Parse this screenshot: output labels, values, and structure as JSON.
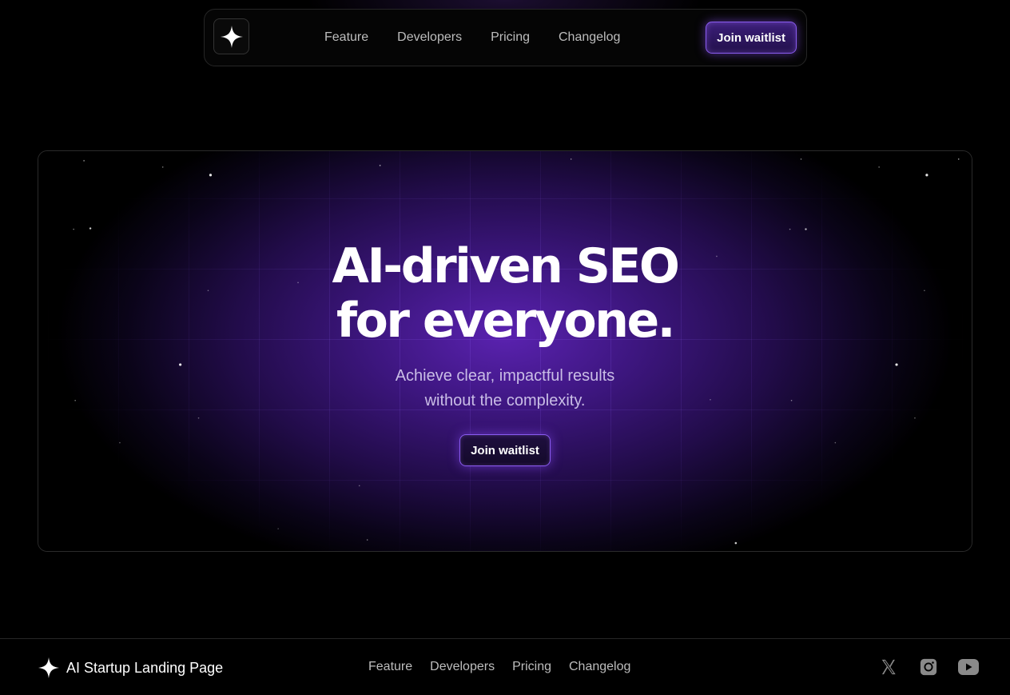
{
  "header": {
    "logo_icon": "sparkle-icon",
    "nav": [
      {
        "label": "Feature"
      },
      {
        "label": "Developers"
      },
      {
        "label": "Pricing"
      },
      {
        "label": "Changelog"
      }
    ],
    "cta_label": "Join waitlist"
  },
  "hero": {
    "title_line1": "AI-driven SEO",
    "title_line2": "for everyone.",
    "subtitle_line1": "Achieve clear, impactful results",
    "subtitle_line2": "without the complexity.",
    "cta_label": "Join waitlist"
  },
  "footer": {
    "brand_icon": "sparkle-icon",
    "brand": "AI Startup Landing Page",
    "nav": [
      {
        "label": "Feature"
      },
      {
        "label": "Developers"
      },
      {
        "label": "Pricing"
      },
      {
        "label": "Changelog"
      }
    ],
    "social": [
      {
        "icon": "x-twitter-icon"
      },
      {
        "icon": "instagram-icon"
      },
      {
        "icon": "youtube-icon"
      }
    ]
  },
  "colors": {
    "background": "#000000",
    "accent": "#8a5cf0",
    "hero_glow": "#5a22b0",
    "muted_text": "#bdbdbd"
  }
}
